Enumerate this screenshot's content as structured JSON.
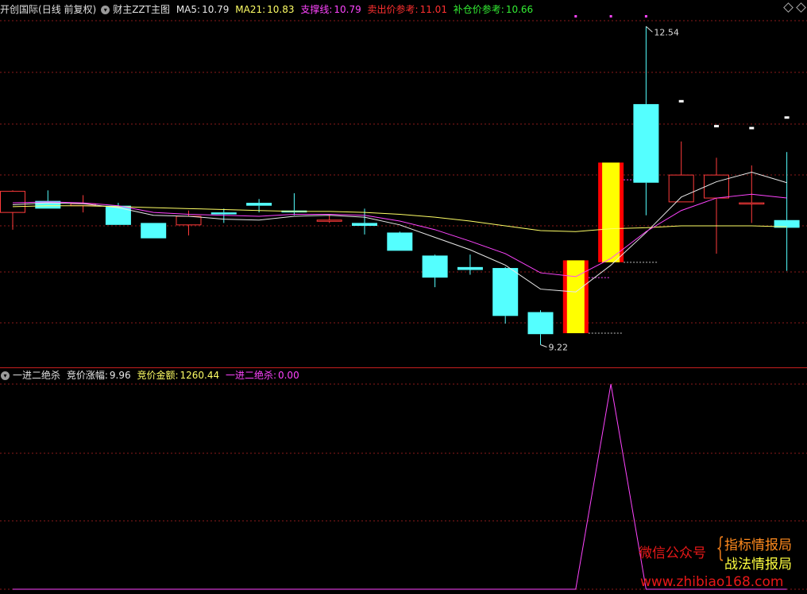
{
  "main_header": {
    "stock": "开创国际",
    "mode": "(日线 前复权)",
    "indicator": "财主ZZT主图",
    "ma5_label": "MA5:",
    "ma5_value": "10.79",
    "ma21_label": "MA21:",
    "ma21_value": "10.83",
    "support_label": "支撑线:",
    "support_value": "10.79",
    "sell_label": "卖出价参考:",
    "sell_value": "11.01",
    "buy_label": "补仓价参考:",
    "buy_value": "10.66"
  },
  "sub_header": {
    "indicator": "一进二绝杀",
    "bid_change_label": "竞价涨幅:",
    "bid_change_value": "9.96",
    "bid_amount_label": "竞价金额:",
    "bid_amount_value": "1260.44",
    "signal_label": "一进二绝杀:",
    "signal_value": "0.00"
  },
  "watermark": {
    "wechat": "微信公众号",
    "brace": "{",
    "line1": "指标情报局",
    "line2": "战法情报局",
    "site": "www.zhibiao168.com"
  },
  "colors": {
    "up": "#ff3b3b",
    "down": "#54ffff",
    "ma5": "#e8e8e8",
    "ma21": "#ffff66",
    "support": "#ff44ff",
    "grid": "#8b1a1a",
    "limit_up_fill": "#ffff00",
    "limit_up_edge": "#ff0000"
  },
  "chart_data": [
    {
      "type": "candlestick",
      "title": "财主ZZT主图",
      "y_range": [
        9.0,
        12.7
      ],
      "max_label": "12.54",
      "min_label": "9.22",
      "candles": [
        {
          "o": 10.6,
          "h": 10.83,
          "l": 10.42,
          "c": 10.82
        },
        {
          "o": 10.72,
          "h": 10.83,
          "l": 10.64,
          "c": 10.64
        },
        {
          "o": 10.67,
          "h": 10.78,
          "l": 10.6,
          "c": 10.69
        },
        {
          "o": 10.67,
          "h": 10.7,
          "l": 10.47,
          "c": 10.47
        },
        {
          "o": 10.49,
          "h": 10.49,
          "l": 10.33,
          "c": 10.33
        },
        {
          "o": 10.47,
          "h": 10.62,
          "l": 10.36,
          "c": 10.56
        },
        {
          "o": 10.6,
          "h": 10.64,
          "l": 10.49,
          "c": 10.58
        },
        {
          "o": 10.7,
          "h": 10.74,
          "l": 10.6,
          "c": 10.67
        },
        {
          "o": 10.62,
          "h": 10.8,
          "l": 10.57,
          "c": 10.6
        },
        {
          "o": 10.52,
          "h": 10.57,
          "l": 10.49,
          "c": 10.52
        },
        {
          "o": 10.49,
          "h": 10.64,
          "l": 10.37,
          "c": 10.46
        },
        {
          "o": 10.39,
          "h": 10.4,
          "l": 10.2,
          "c": 10.2
        },
        {
          "o": 10.15,
          "h": 10.16,
          "l": 9.82,
          "c": 9.92
        },
        {
          "o": 10.03,
          "h": 10.16,
          "l": 9.95,
          "c": 10.0
        },
        {
          "o": 10.02,
          "h": 10.03,
          "l": 9.44,
          "c": 9.52
        },
        {
          "o": 9.56,
          "h": 9.58,
          "l": 9.22,
          "c": 9.33
        },
        {
          "o": 9.34,
          "h": 10.1,
          "l": 9.34,
          "c": 10.1,
          "limit": true
        },
        {
          "o": 10.08,
          "h": 11.12,
          "l": 10.08,
          "c": 11.12,
          "limit": true
        },
        {
          "o": 11.73,
          "h": 12.54,
          "l": 10.57,
          "c": 10.91
        },
        {
          "o": 10.71,
          "h": 11.34,
          "l": 10.71,
          "c": 10.99
        },
        {
          "o": 10.75,
          "h": 11.17,
          "l": 10.17,
          "c": 10.99
        },
        {
          "o": 10.7,
          "h": 11.09,
          "l": 10.49,
          "c": 10.7
        },
        {
          "o": 10.52,
          "h": 11.23,
          "l": 9.99,
          "c": 10.44
        }
      ],
      "series": [
        {
          "name": "MA5",
          "values": [
            10.68,
            10.7,
            10.69,
            10.65,
            10.57,
            10.56,
            10.53,
            10.52,
            10.56,
            10.57,
            10.55,
            10.47,
            10.34,
            10.21,
            10.05,
            9.8,
            9.77,
            10.05,
            10.39,
            10.76,
            10.92,
            11.02,
            10.91
          ]
        },
        {
          "name": "MA21",
          "values": [
            10.66,
            10.67,
            10.67,
            10.66,
            10.65,
            10.64,
            10.63,
            10.62,
            10.61,
            10.61,
            10.6,
            10.58,
            10.55,
            10.51,
            10.46,
            10.41,
            10.4,
            10.43,
            10.44,
            10.46,
            10.46,
            10.46,
            10.45
          ]
        },
        {
          "name": "支撑线",
          "values": [
            10.7,
            10.71,
            10.7,
            10.67,
            10.6,
            10.58,
            10.57,
            10.56,
            10.58,
            10.58,
            10.57,
            10.51,
            10.42,
            10.3,
            10.17,
            9.97,
            9.93,
            10.12,
            10.4,
            10.62,
            10.75,
            10.79,
            10.75
          ]
        }
      ],
      "top_markers": [
        16,
        17,
        18
      ],
      "tick_markers": [
        {
          "i": 19,
          "v": 11.76
        },
        {
          "i": 20,
          "v": 11.5
        },
        {
          "i": 21,
          "v": 11.48
        },
        {
          "i": 22,
          "v": 11.59
        }
      ]
    },
    {
      "type": "line",
      "title": "一进二绝杀",
      "y_range": [
        0,
        1
      ],
      "series": [
        {
          "name": "一进二绝杀",
          "values": [
            0,
            0,
            0,
            0,
            0,
            0,
            0,
            0,
            0,
            0,
            0,
            0,
            0,
            0,
            0,
            0,
            0,
            1,
            0,
            0,
            0,
            0,
            0
          ]
        }
      ]
    }
  ]
}
